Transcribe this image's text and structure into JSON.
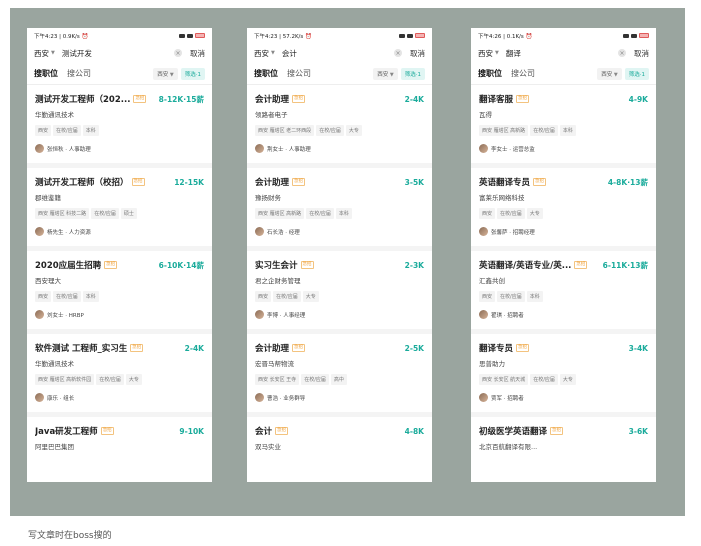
{
  "caption": "写文章时在boss搜的",
  "cancel_label": "取消",
  "tab_jobs": "搜职位",
  "tab_companies": "搜公司",
  "filter_label": "筛选·1",
  "phones": [
    {
      "status_time": "下午4:23 | 0.9K/s ⏰",
      "city": "西安",
      "query": "测试开发",
      "cards": [
        {
          "title": "测试开发工程师（202...",
          "badge": "急招",
          "salary": "8-12K·15薪",
          "company": "华勤通讯技术",
          "tags": [
            "西安",
            "在校/应届",
            "本科"
          ],
          "recruiter": "张恒秋 · 人事助理"
        },
        {
          "title": "测试开发工程师（校招）",
          "badge": "急招",
          "salary": "12-15K",
          "company": "郡维鉴籍",
          "tags": [
            "西安 雁塔区 科技二路",
            "在校/应届",
            "硕士"
          ],
          "recruiter": "杨先生 · 人力资源"
        },
        {
          "title": "2020应届生招聘",
          "badge": "急招",
          "salary": "6-10K·14薪",
          "company": "西安理大",
          "tags": [
            "西安",
            "在校/应届",
            "本科"
          ],
          "recruiter": "刘女士 · HRBP"
        },
        {
          "title": "软件测试 工程师_实习生",
          "badge": "急招",
          "salary": "2-4K",
          "company": "华勤通讯技术",
          "tags": [
            "西安 雁塔区 高新软件园",
            "在校/应届",
            "大专"
          ],
          "recruiter": "康乐 · 组长"
        },
        {
          "title": "Java研发工程师",
          "badge": "急招",
          "salary": "9-10K",
          "company": "阿里巴巴集团",
          "tags": [],
          "recruiter": ""
        }
      ]
    },
    {
      "status_time": "下午4:23 | 57.2K/s ⏰",
      "city": "西安",
      "query": "会计",
      "cards": [
        {
          "title": "会计助理",
          "badge": "急招",
          "salary": "2-4K",
          "company": "领路者电子",
          "tags": [
            "西安 雁塔区 老二环西段",
            "在校/应届",
            "大专"
          ],
          "recruiter": "荆女士 · 人事助理"
        },
        {
          "title": "会计助理",
          "badge": "急招",
          "salary": "3-5K",
          "company": "豫扬财务",
          "tags": [
            "西安 雁塔区 高新路",
            "在校/应届",
            "本科"
          ],
          "recruiter": "石长浩 · 经理"
        },
        {
          "title": "实习生会计",
          "badge": "急招",
          "salary": "2-3K",
          "company": "君之企财务管理",
          "tags": [
            "西安",
            "在校/应届",
            "大专"
          ],
          "recruiter": "李博 · 人事经理"
        },
        {
          "title": "会计助理",
          "badge": "急招",
          "salary": "2-5K",
          "company": "宏晋马帮物流",
          "tags": [
            "西安 长安区 王寺",
            "在校/应届",
            "高中"
          ],
          "recruiter": "曹浩 · 业务群导"
        },
        {
          "title": "会计",
          "badge": "急招",
          "salary": "4-8K",
          "company": "双马实业",
          "tags": [],
          "recruiter": ""
        }
      ]
    },
    {
      "status_time": "下午4:26 | 0.1K/s ⏰",
      "city": "西安",
      "query": "翻译",
      "cards": [
        {
          "title": "翻译客服",
          "badge": "急招",
          "salary": "4-9K",
          "company": "瓦得",
          "tags": [
            "西安 雁塔区 高新路",
            "在校/应届",
            "本科"
          ],
          "recruiter": "李女士 · 运营总监"
        },
        {
          "title": "英语翻译专员",
          "badge": "急招",
          "salary": "4-8K·13薪",
          "company": "富莱乐网络科技",
          "tags": [
            "西安",
            "在校/应届",
            "大专"
          ],
          "recruiter": "张馨萨 · 招聘经理"
        },
        {
          "title": "英语翻译/英语专业/英...",
          "badge": "急招",
          "salary": "6-11K·13薪",
          "company": "汇鑫共创",
          "tags": [
            "西安",
            "在校/应届",
            "本科"
          ],
          "recruiter": "翟琪 · 招聘者"
        },
        {
          "title": "翻译专员",
          "badge": "急招",
          "salary": "3-4K",
          "company": "思普助力",
          "tags": [
            "西安 长安区 航天城",
            "在校/应届",
            "大专"
          ],
          "recruiter": "贾军 · 招聘者"
        },
        {
          "title": "初级医学英语翻译",
          "badge": "急招",
          "salary": "3-6K",
          "company": "北京百航翻译有限...",
          "tags": [],
          "recruiter": ""
        }
      ]
    }
  ]
}
